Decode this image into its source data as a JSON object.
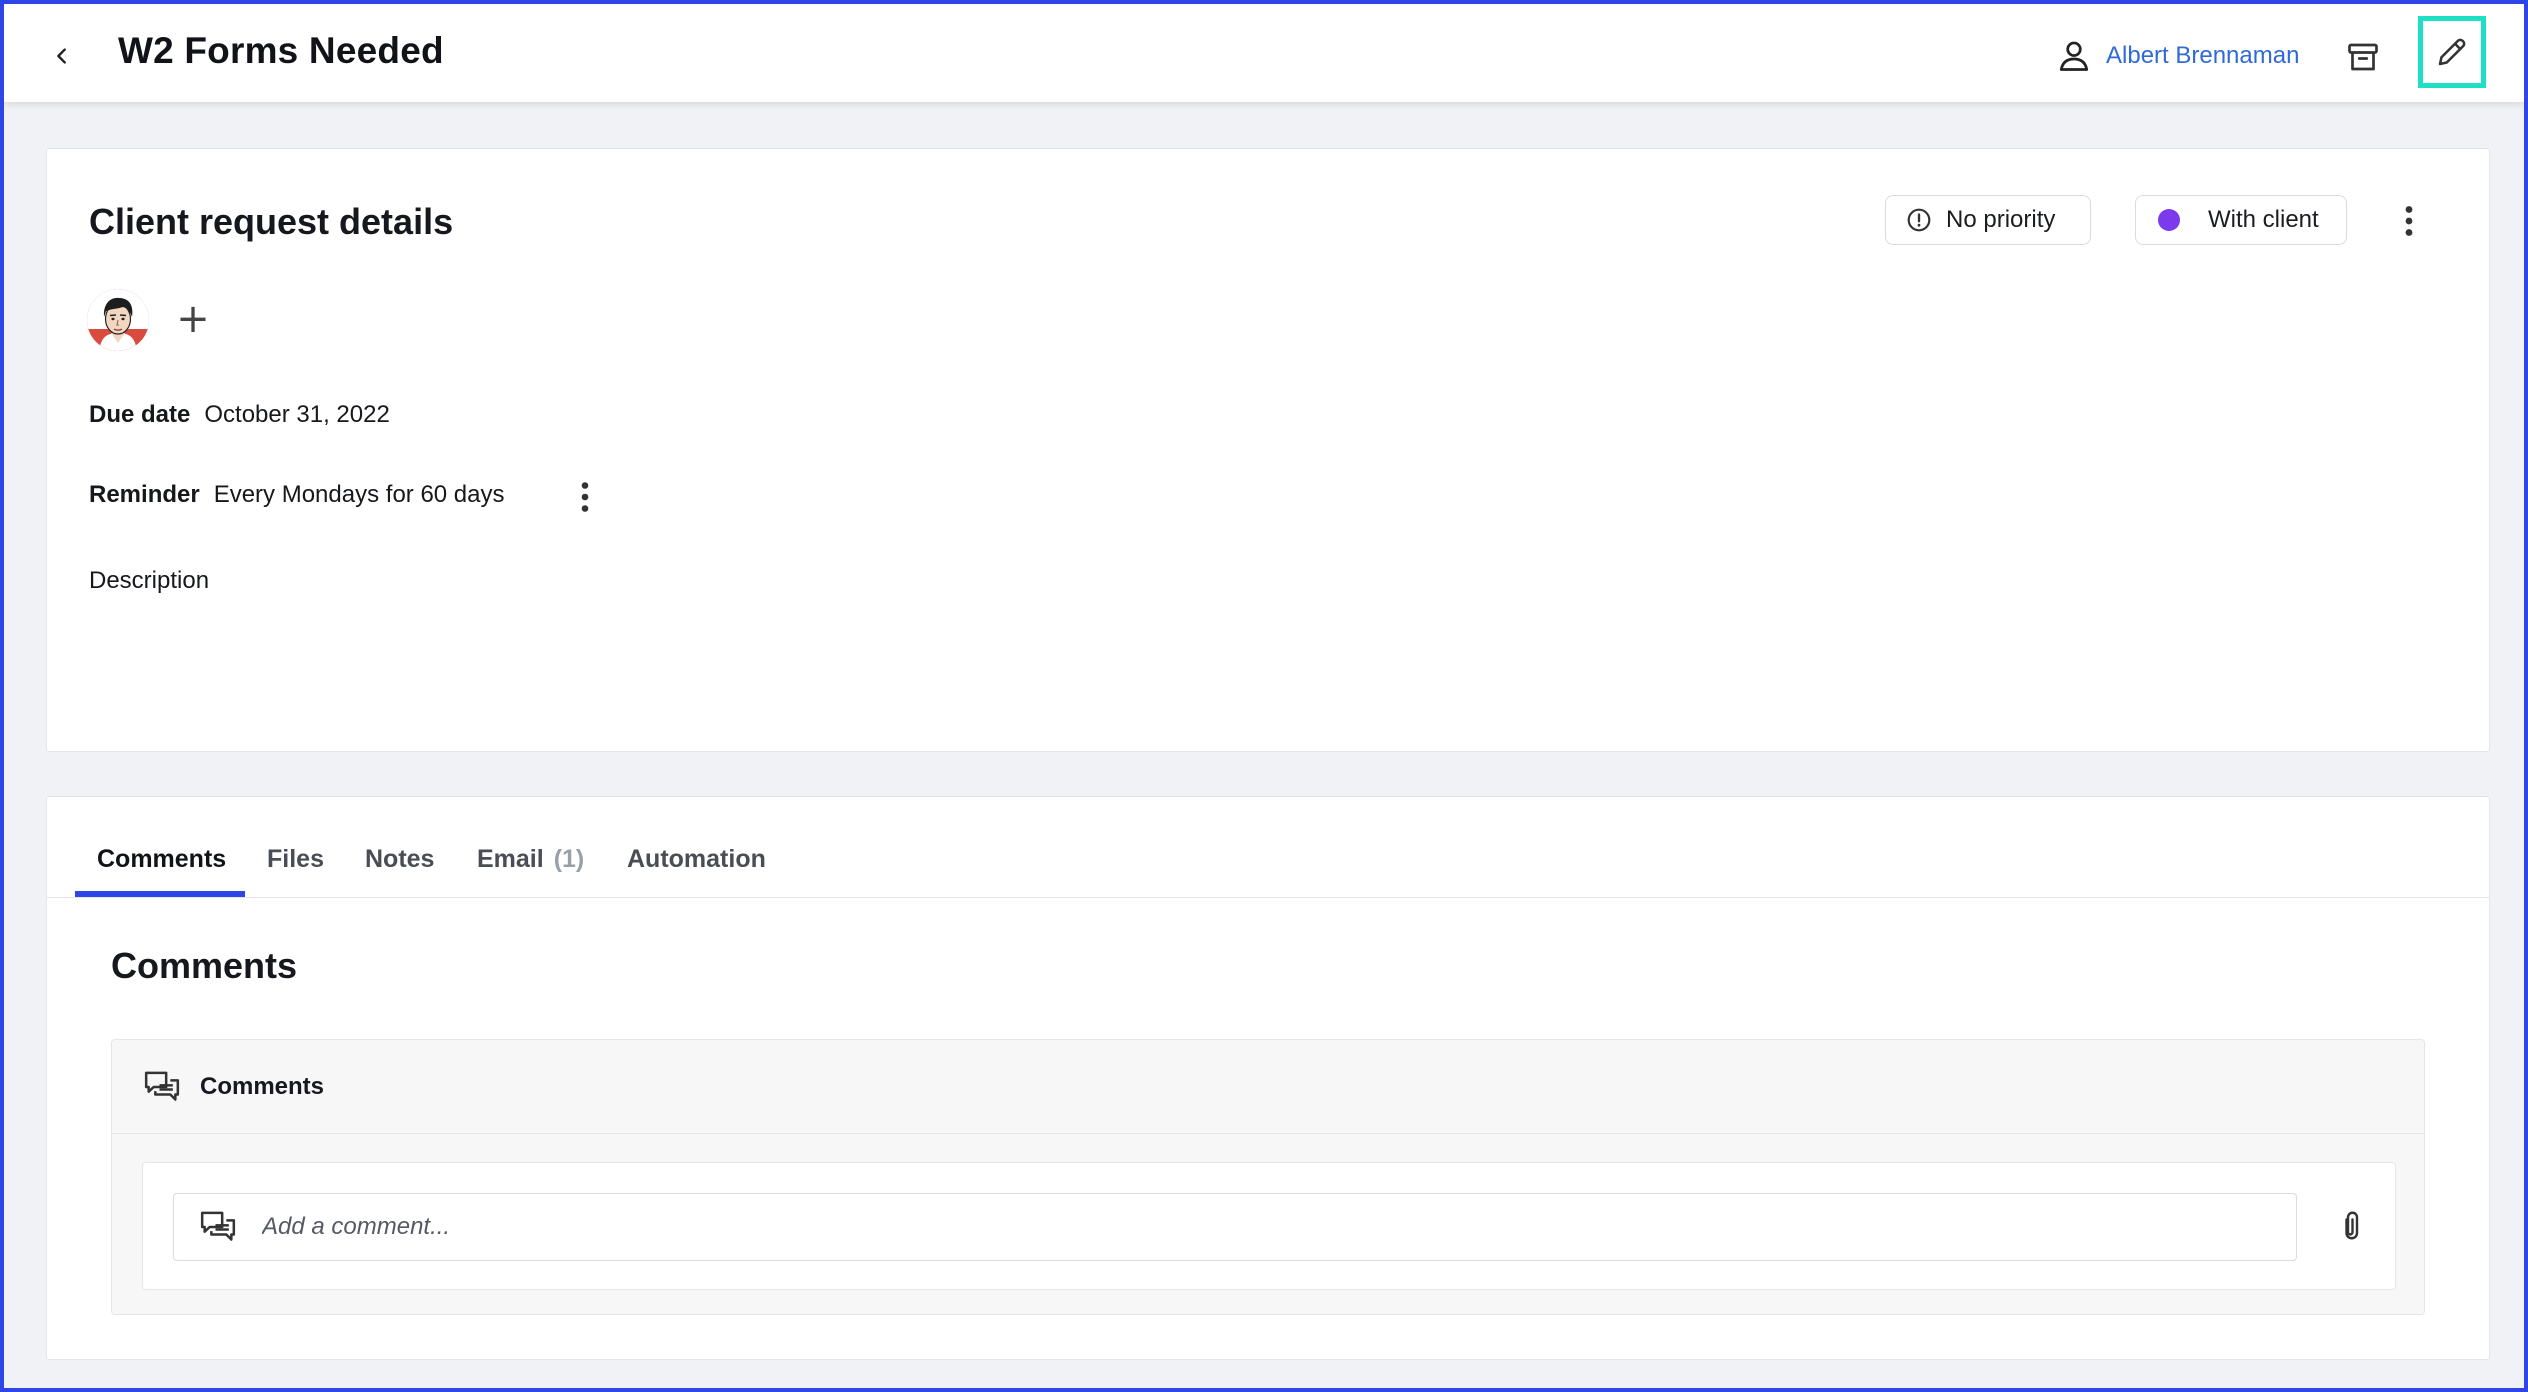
{
  "header": {
    "title": "W2 Forms Needed",
    "assignee_name": "Albert Brennaman"
  },
  "details": {
    "title": "Client request details",
    "priority_label": "No priority",
    "status_label": "With client",
    "status_color": "#7c3aed",
    "add_member_symbol": "+",
    "due_date_label": "Due date",
    "due_date_value": "October 31, 2022",
    "reminder_label": "Reminder",
    "reminder_value": "Every Mondays for 60 days",
    "description_label": "Description"
  },
  "tabs": {
    "items": [
      {
        "label": "Comments",
        "active": true
      },
      {
        "label": "Files"
      },
      {
        "label": "Notes"
      },
      {
        "label": "Email",
        "count": "(1)"
      },
      {
        "label": "Automation"
      }
    ],
    "accent": "#2f46e6"
  },
  "comments": {
    "heading": "Comments",
    "panel_title": "Comments",
    "input_placeholder": "Add a comment..."
  },
  "colors": {
    "link": "#2f6ad6",
    "highlight": "#1ddfc3",
    "frame": "#2f46e6"
  }
}
